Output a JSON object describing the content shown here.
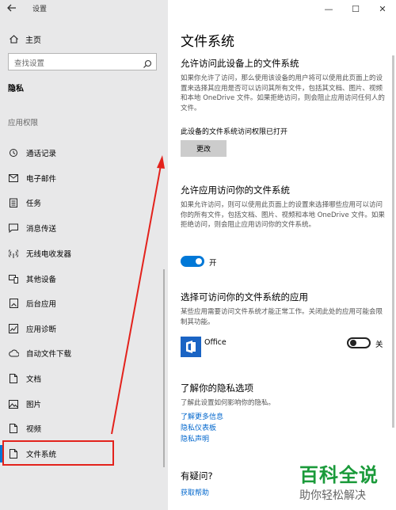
{
  "window": {
    "app_title": "设置",
    "controls": [
      "—",
      "☐",
      "✕"
    ]
  },
  "sidebar": {
    "home_label": "主页",
    "search_placeholder": "查找设置",
    "section_privacy": "隐私",
    "section_permissions": "应用权限",
    "items": [
      {
        "label": "通话记录",
        "icon": "call-history-icon"
      },
      {
        "label": "电子邮件",
        "icon": "email-icon"
      },
      {
        "label": "任务",
        "icon": "tasks-icon"
      },
      {
        "label": "消息传送",
        "icon": "messaging-icon"
      },
      {
        "label": "无线电收发器",
        "icon": "radio-icon"
      },
      {
        "label": "其他设备",
        "icon": "other-devices-icon"
      },
      {
        "label": "后台应用",
        "icon": "background-apps-icon"
      },
      {
        "label": "应用诊断",
        "icon": "app-diagnostics-icon"
      },
      {
        "label": "自动文件下载",
        "icon": "cloud-icon"
      },
      {
        "label": "文档",
        "icon": "document-icon"
      },
      {
        "label": "图片",
        "icon": "pictures-icon"
      },
      {
        "label": "视频",
        "icon": "videos-icon"
      },
      {
        "label": "文件系统",
        "icon": "file-system-icon",
        "active": true
      }
    ]
  },
  "main": {
    "title": "文件系统",
    "section1": {
      "heading": "允许访问此设备上的文件系统",
      "description": "如果你允许了访问，那么使用该设备的用户将可以使用此页面上的设置来选择其应用是否可以访问其所有文件，包括其文档、图片、视频和本地 OneDrive 文件。如果拒绝访问，则会阻止应用访问任何人的文件。",
      "status": "此设备的文件系统访问权限已打开",
      "change_button": "更改"
    },
    "section2": {
      "heading": "允许应用访问你的文件系统",
      "description": "如果允许访问，则可以使用此页面上的设置来选择哪些应用可以访问你的所有文件，包括文档、图片、视频和本地 OneDrive 文件。如果拒绝访问，则会阻止应用访问你的文件系统。",
      "toggle_label": "开",
      "toggle_state": "on"
    },
    "section3": {
      "heading": "选择可访问你的文件系统的应用",
      "description": "某些应用需要访问文件系统才能正常工作。关闭此处的应用可能会限制其功能。",
      "apps": [
        {
          "name": "Office",
          "toggle_label": "关",
          "toggle_state": "off"
        }
      ]
    },
    "section4": {
      "heading": "了解你的隐私选项",
      "description": "了解此设置如何影响你的隐私。",
      "links": [
        "了解更多信息",
        "隐私仪表板",
        "隐私声明"
      ]
    },
    "section5": {
      "heading": "有疑问?",
      "link": "获取帮助"
    }
  },
  "watermark": {
    "title": "百科全说",
    "subtitle": "助你轻松解决"
  },
  "colors": {
    "accent": "#0078d7",
    "highlight": "#e3221c",
    "watermark": "#1a9a3a"
  }
}
